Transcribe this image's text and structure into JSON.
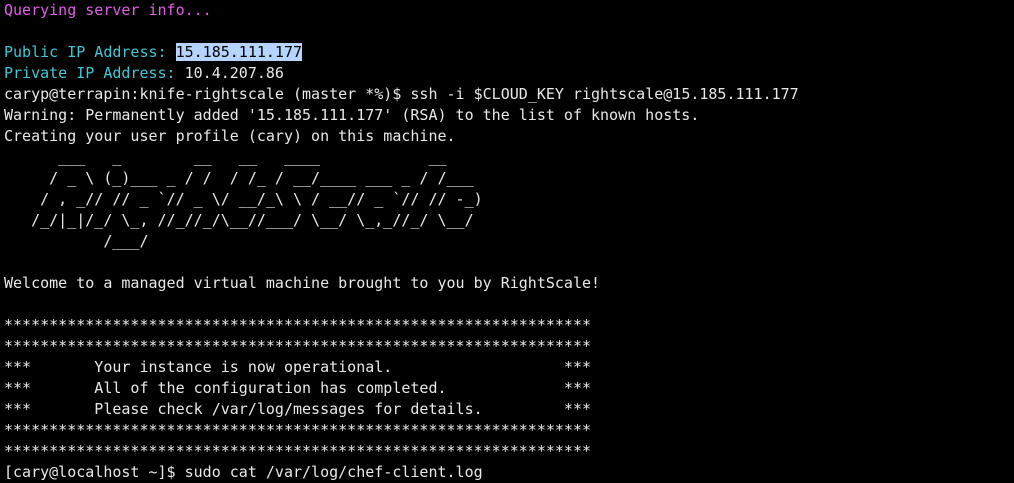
{
  "terminal": {
    "colors": {
      "background": "#000000",
      "text": "#e8e8e8",
      "status": "#e25ee8",
      "label": "#3fc7d6",
      "selection": "#b5d5ff"
    },
    "status_line": "Querying server info...",
    "public_ip_label": "Public IP Address:",
    "public_ip_value": "15.185.111.177",
    "private_ip_label": "Private IP Address:",
    "private_ip_value": "10.4.207.86",
    "ssh_prompt": "caryp@terrapin:knife-rightscale (master *%)$",
    "ssh_command": "ssh -i $CLOUD_KEY rightscale@15.185.111.177",
    "warning_line": "Warning: Permanently added '15.185.111.177' (RSA) to the list of known hosts.",
    "profile_line": "Creating your user profile (cary) on this machine.",
    "banner": [
      "      ___   _        __   __   ____            __",
      "     / _ \\ (_)___ _ / /  / /_ / __/____ ___ _ / /___",
      "    / , _// // _ `// _ \\/ __/_\\ \\ / __// _ `// // -_)",
      "   /_/|_|/_/ \\_, //_//_/\\__//___/ \\__/ \\_,_//_/ \\__/",
      "           /___/"
    ],
    "welcome_line": "Welcome to a managed virtual machine brought to you by RightScale!",
    "box_border": "*****************************************************************",
    "box_lines": [
      "***       Your instance is now operational.                   ***",
      "***       All of the configuration has completed.             ***",
      "***       Please check /var/log/messages for details.         ***"
    ],
    "final_prompt": "[cary@localhost ~]$",
    "final_command": "sudo cat /var/log/chef-client.log"
  }
}
